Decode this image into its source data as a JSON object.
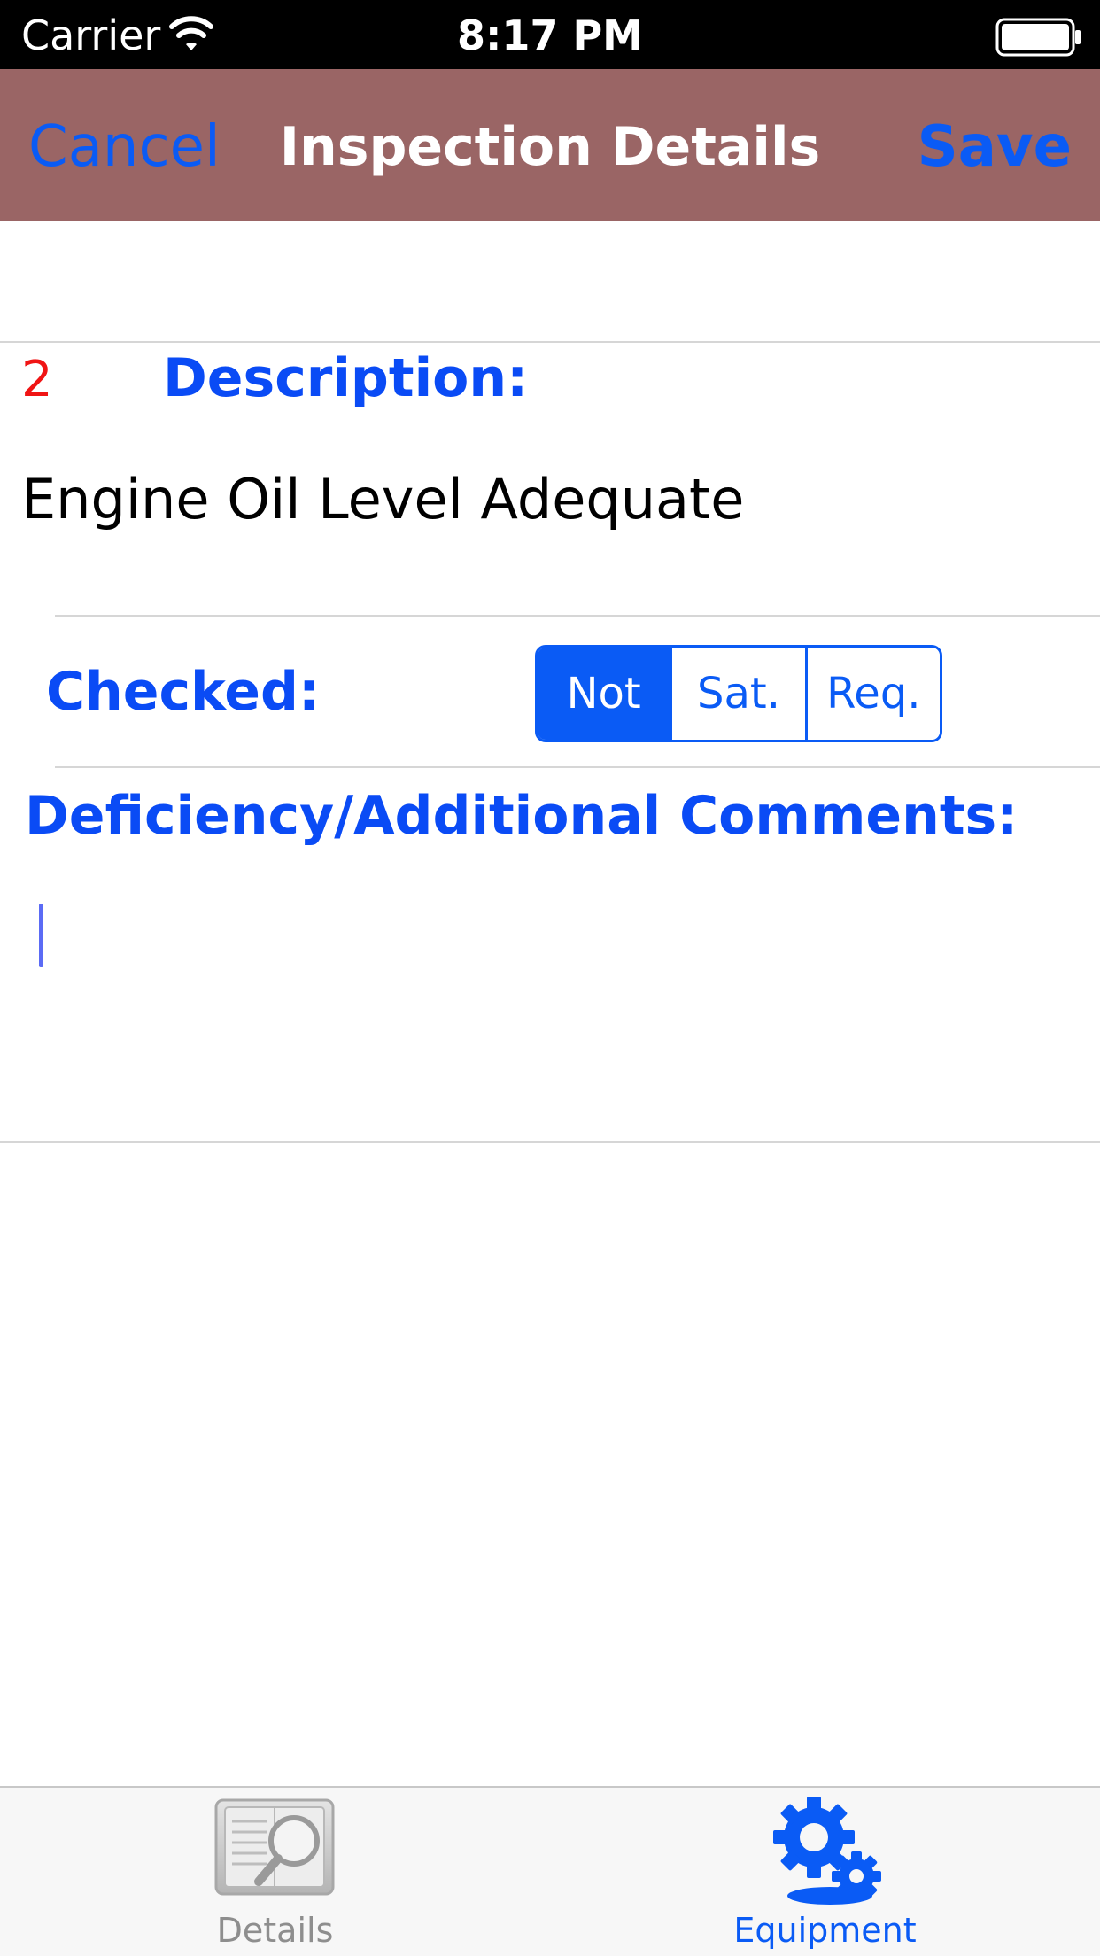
{
  "status_bar": {
    "carrier": "Carrier",
    "time": "8:17 PM",
    "wifi_icon": "wifi-icon",
    "battery_icon": "battery-icon"
  },
  "nav": {
    "cancel_label": "Cancel",
    "title": "Inspection Details",
    "save_label": "Save",
    "background_color": "#9a6565",
    "button_color": "#0a5bf5"
  },
  "item": {
    "number": "2",
    "description_label": "Description:",
    "description_value": "Engine Oil Level Adequate"
  },
  "checked": {
    "label": "Checked:",
    "options": [
      "Not",
      "Sat.",
      "Req."
    ],
    "selected": "Not"
  },
  "comments": {
    "label": "Deficiency/Additional Comments:",
    "value": ""
  },
  "tab_bar": {
    "tabs": [
      {
        "label": "Details",
        "icon": "details-magnifier-icon",
        "selected": false
      },
      {
        "label": "Equipment",
        "icon": "gears-icon",
        "selected": true
      }
    ]
  },
  "colors": {
    "label_blue": "#0a4bf5",
    "item_number_red": "#f01414",
    "accent": "#0a5bf5"
  }
}
